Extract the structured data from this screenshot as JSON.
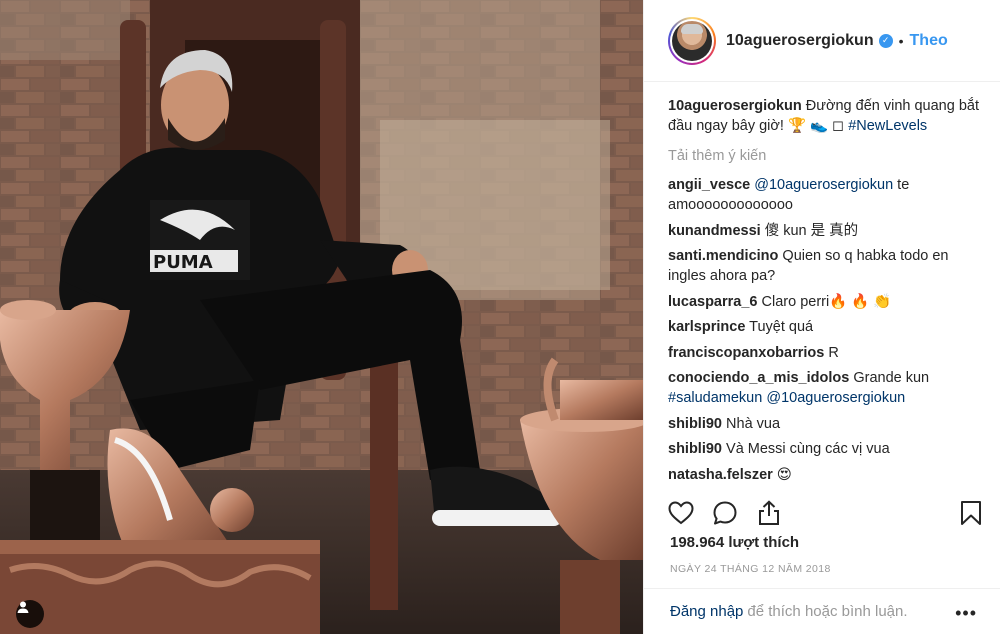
{
  "post": {
    "author": "10aguerosergiokun",
    "verified_icon": "verified-badge-icon",
    "separator": "•",
    "follow_label": "Theo",
    "caption_text": " Đường đến vinh quang bắt đầu ngay bây giờ! 🏆 👟 ◻ ",
    "caption_hashtag": "#NewLevels",
    "load_more_label": "Tải thêm ý kiến",
    "likes_text": "198.964 lượt thích",
    "date_text": "NGÀY 24 THÁNG 12 NĂM 2018"
  },
  "comments": [
    {
      "user": "angii_vesce",
      "mention": "@10aguerosergiokun",
      "text": " te amooooooooooooo"
    },
    {
      "user": "kunandmessi",
      "text": " 傻 kun 是 真的"
    },
    {
      "user": "santi.mendicino",
      "text": " Quien so q habka todo en ingles ahora pa?"
    },
    {
      "user": "lucasparra_6",
      "text": " Claro perri🔥 🔥 👏"
    },
    {
      "user": "karlsprince",
      "text": " Tuyệt quá"
    },
    {
      "user": "franciscopanxobarrios",
      "text": " R"
    },
    {
      "user": "conociendo_a_mis_idolos",
      "text": " Grande kun ",
      "hashtag": "#saludamekun",
      "mention": " @10aguerosergiokun"
    },
    {
      "user": "shibli90",
      "text": " Nhà vua"
    },
    {
      "user": "shibli90",
      "text": " Và Messi cùng các vị vua"
    },
    {
      "user": "natasha.felszer",
      "text": " 😍"
    }
  ],
  "footer": {
    "login_label": "Đăng nhập",
    "login_rest": "để thích hoặc bình luận.",
    "more_label": "•••"
  },
  "icons": {
    "like": "heart-icon",
    "comment": "comment-bubble-icon",
    "share": "share-icon",
    "save": "bookmark-icon",
    "tag": "user-tag-icon"
  },
  "colors": {
    "link_blue": "#3897f0",
    "hashtag_blue": "#003569",
    "muted_gray": "#999999",
    "text": "#262626"
  }
}
